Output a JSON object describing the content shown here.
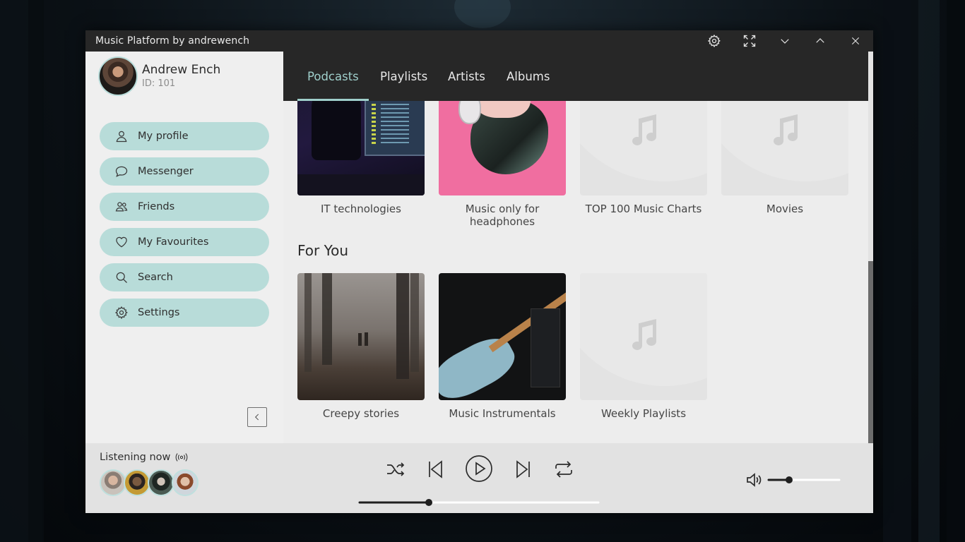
{
  "window": {
    "title": "Music Platform by andrewench"
  },
  "titlebar_icons": [
    "gear-icon",
    "fullscreen-icon",
    "chevron-down-icon",
    "chevron-up-icon",
    "close-icon"
  ],
  "user": {
    "name": "Andrew Ench",
    "id_label": "ID: 101"
  },
  "sidebar": {
    "items": [
      {
        "label": "My profile",
        "icon": "user-icon"
      },
      {
        "label": "Messenger",
        "icon": "chat-icon"
      },
      {
        "label": "Friends",
        "icon": "friends-icon"
      },
      {
        "label": "My Favourites",
        "icon": "heart-icon"
      },
      {
        "label": "Search",
        "icon": "search-icon"
      },
      {
        "label": "Settings",
        "icon": "gear-icon"
      }
    ]
  },
  "tabs": [
    {
      "label": "Podcasts",
      "active": true
    },
    {
      "label": "Playlists",
      "active": false
    },
    {
      "label": "Artists",
      "active": false
    },
    {
      "label": "Albums",
      "active": false
    }
  ],
  "content": {
    "top_row": [
      {
        "label": "IT technologies"
      },
      {
        "label": "Music only for headphones"
      },
      {
        "label": "TOP 100 Music Charts"
      },
      {
        "label": "Movies"
      }
    ],
    "section_title": "For You",
    "for_you": [
      {
        "label": "Creepy stories"
      },
      {
        "label": "Music Instrumentals"
      },
      {
        "label": "Weekly Playlists"
      }
    ]
  },
  "player": {
    "listening_label": "Listening now",
    "progress": 0.29,
    "volume": 0.29
  },
  "colors": {
    "accent": "#b8dcd9",
    "tab_active": "#9fcfcb",
    "titlebar": "#272727"
  }
}
